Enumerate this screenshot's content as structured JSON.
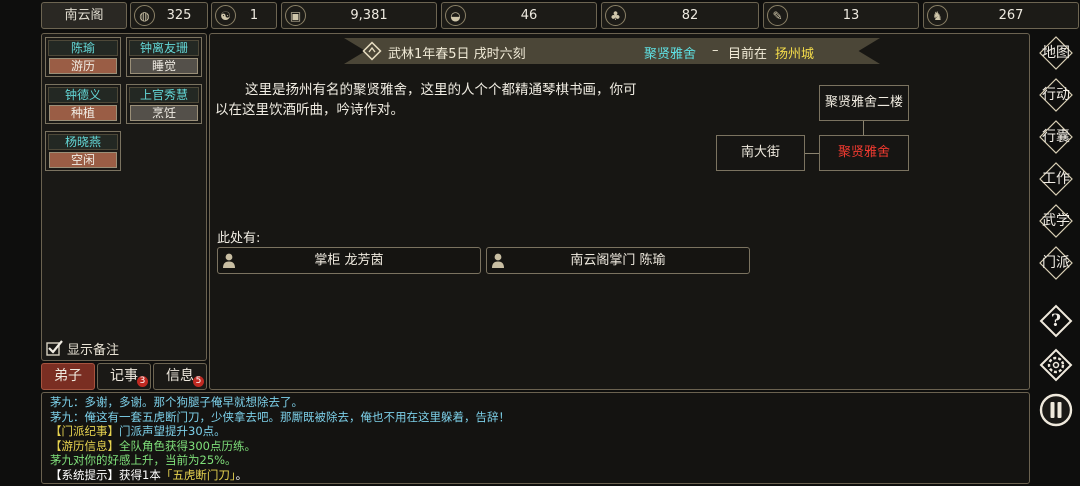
{
  "top": {
    "sect_name": "南云阁",
    "resources": [
      {
        "icon": "coin-bag-icon",
        "value": "325"
      },
      {
        "icon": "yin-yang-icon",
        "value": "1"
      },
      {
        "icon": "copper-coin-icon",
        "value": "9,381"
      },
      {
        "icon": "rice-bowl-icon",
        "value": "46"
      },
      {
        "icon": "herb-icon",
        "value": "82"
      },
      {
        "icon": "scroll-icon",
        "value": "13"
      },
      {
        "icon": "beast-icon",
        "value": "267"
      }
    ]
  },
  "disciples": [
    {
      "name": "陈瑜",
      "status": "游历",
      "busy": true
    },
    {
      "name": "钟离友珊",
      "status": "睡觉",
      "busy": false
    },
    {
      "name": "钟德义",
      "status": "种植",
      "busy": true
    },
    {
      "name": "上官秀慧",
      "status": "烹饪",
      "busy": false
    },
    {
      "name": "杨晓燕",
      "status": "空闲",
      "busy": true
    }
  ],
  "show_notes_label": "显示备注",
  "tabs": [
    {
      "label": "弟子",
      "badge": ""
    },
    {
      "label": "记事",
      "badge": "3"
    },
    {
      "label": "信息",
      "badge": "5"
    }
  ],
  "header": {
    "date": "武林1年春5日 戌时六刻",
    "location": "聚贤雅舍",
    "separator": "–",
    "at_prefix": "目前在",
    "city": "扬州城"
  },
  "description": {
    "line1": "这里是扬州有名的聚贤雅舍，这里的人个个都精通琴棋书画，你可",
    "line2": "以在这里饮酒听曲，吟诗作对。"
  },
  "map": {
    "up": "聚贤雅舍二楼",
    "west": "南大街",
    "current": "聚贤雅舍"
  },
  "here_label": "此处有:",
  "npcs": [
    {
      "label": "掌柜 龙芳茵"
    },
    {
      "label": "南云阁掌门 陈瑜"
    }
  ],
  "side_menu": [
    {
      "label": "地图",
      "icon": "map-icon"
    },
    {
      "label": "行动",
      "icon": "action-icon"
    },
    {
      "label": "行囊",
      "icon": "bag-icon"
    },
    {
      "label": "工作",
      "icon": "work-icon"
    },
    {
      "label": "武学",
      "icon": "martial-arts-icon"
    },
    {
      "label": "门派",
      "icon": "sect-icon"
    },
    {
      "label": "?",
      "icon": "help-icon"
    },
    {
      "label": "",
      "icon": "settings-gear-icon"
    },
    {
      "label": "",
      "icon": "pause-icon"
    }
  ],
  "log": [
    {
      "parts": [
        {
          "text": "茅九：多谢，多谢。那个狗腿子俺早就想除去了。",
          "color": "#7ccfe8"
        }
      ]
    },
    {
      "parts": [
        {
          "text": "茅九：俺这有一套五虎断门刀，少侠拿去吧。那厮既被除去，俺也不用在这里躲着，告辞！",
          "color": "#7ccfe8"
        }
      ]
    },
    {
      "parts": [
        {
          "text": "【门派纪事】",
          "color": "#e8d450"
        },
        {
          "text": "门派声望提升30点。",
          "color": "#7ccfe8"
        }
      ]
    },
    {
      "parts": [
        {
          "text": "【游历信息】",
          "color": "#e8d450"
        },
        {
          "text": "全队角色获得300点历练。",
          "color": "#7fe07a"
        }
      ]
    },
    {
      "parts": [
        {
          "text": "茅九对你的好感上升，当前为25%。",
          "color": "#7fe07a"
        }
      ]
    },
    {
      "parts": [
        {
          "text": "【系统提示】获得1本",
          "color": "#ffffff"
        },
        {
          "text": "「五虎断门刀」",
          "color": "#e8d450"
        },
        {
          "text": "。",
          "color": "#ffffff"
        }
      ]
    }
  ]
}
